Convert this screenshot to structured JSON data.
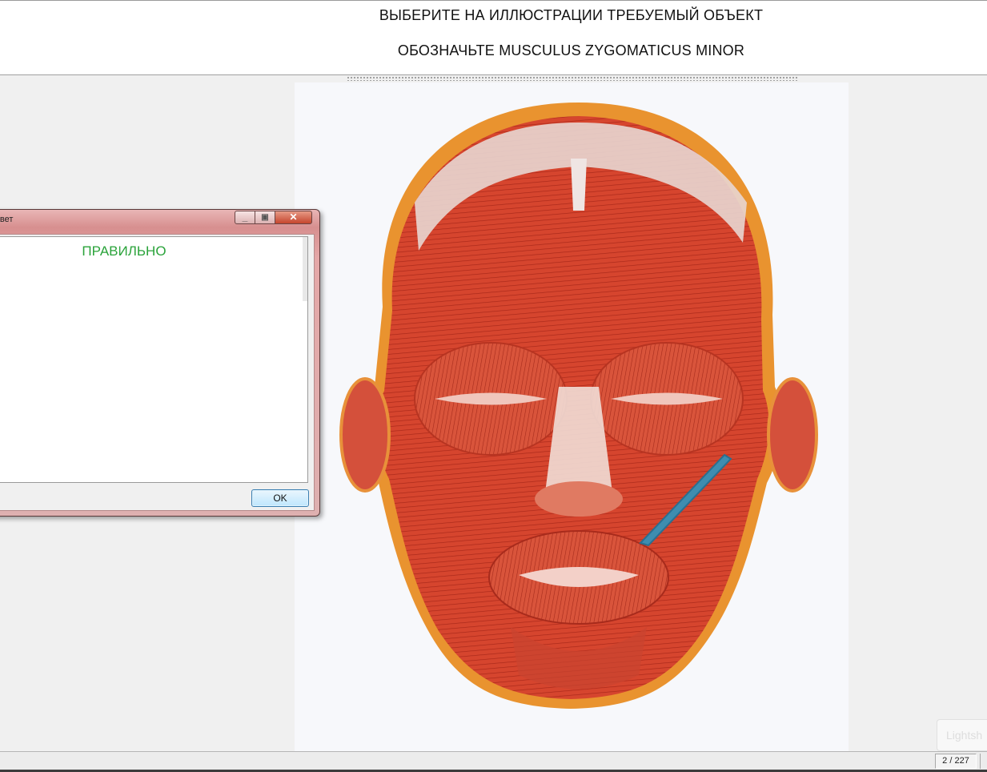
{
  "header": {
    "instruction": "ВЫБЕРИТЕ НА ИЛЛЮСТРАЦИИ ТРЕБУЕМЫЙ ОБЪЕКТ",
    "task": "ОБОЗНАЧЬТЕ  MUSCULUS ZYGOMATICUS MINOR"
  },
  "dialog": {
    "title": "ответ",
    "message": "ПРАВИЛЬНО",
    "message_color": "#2aa33a",
    "ok_label": "OK"
  },
  "status": {
    "page": "2 / 227",
    "watermark_text": "Lightsh"
  },
  "figure": {
    "subject": "facial-muscles-illustration",
    "highlight_color": "#3e8db0"
  }
}
